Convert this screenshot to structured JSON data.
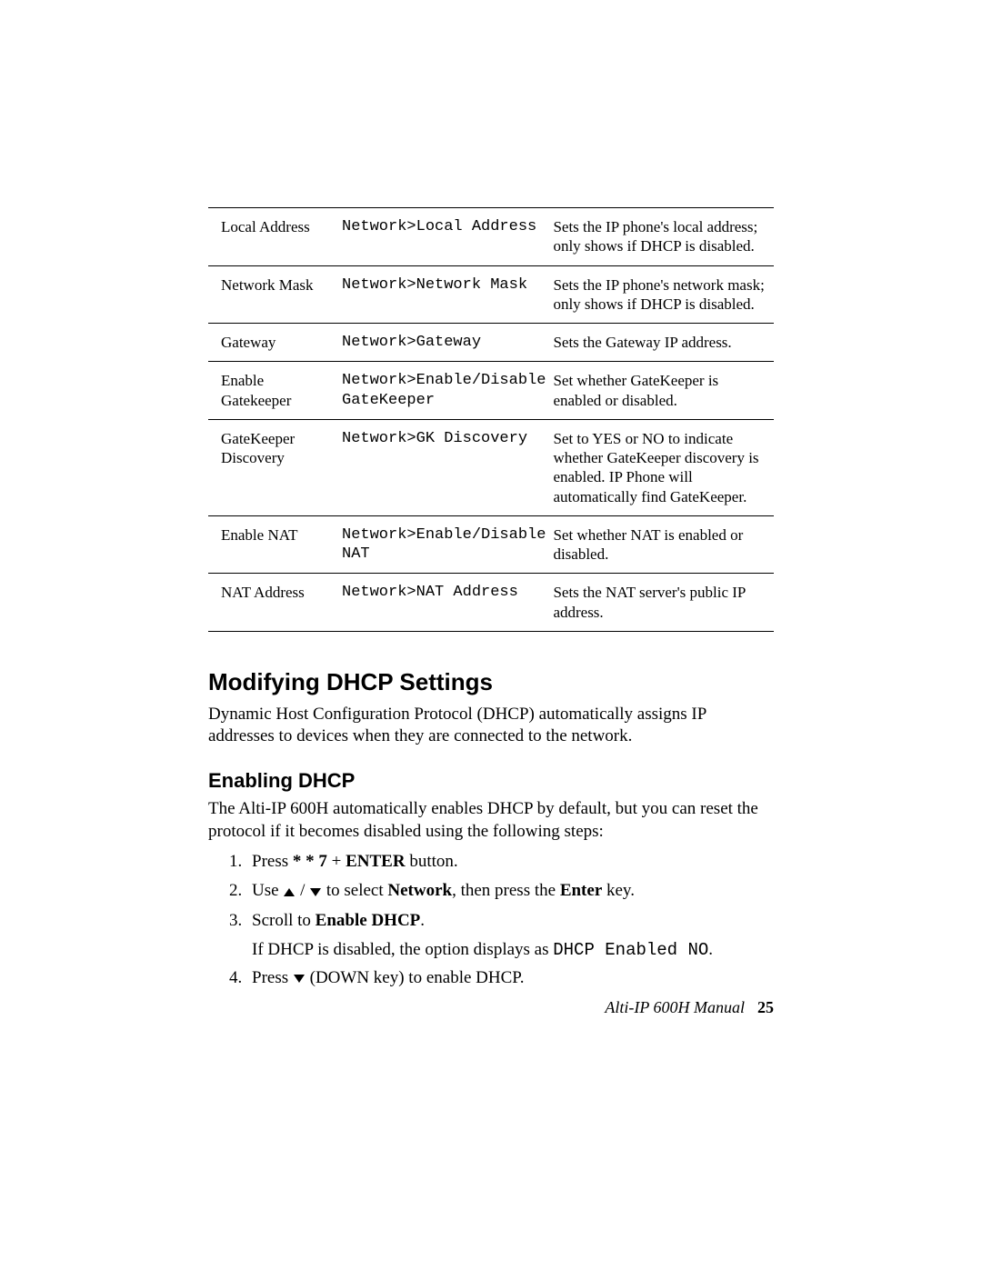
{
  "table": {
    "rows": [
      {
        "name": "Local Address",
        "path": "Network>Local Address",
        "desc": "Sets the IP phone's local address; only shows if DHCP is disabled."
      },
      {
        "name": "Network Mask",
        "path": "Network>Network Mask",
        "desc": "Sets the IP phone's network mask; only shows if DHCP is disabled."
      },
      {
        "name": "Gateway",
        "path": "Network>Gateway",
        "desc": "Sets the Gateway IP address."
      },
      {
        "name": "Enable Gatekeeper",
        "path": "Network>Enable/Disable GateKeeper",
        "desc": "Set whether GateKeeper is enabled or disabled."
      },
      {
        "name": "GateKeeper Discovery",
        "path": "Network>GK Discovery",
        "desc": "Set to YES or NO to indicate whether GateKeeper discovery is enabled. IP Phone will automatically find GateKeeper."
      },
      {
        "name": "Enable NAT",
        "path": "Network>Enable/Disable NAT",
        "desc": "Set whether NAT is enabled or disabled."
      },
      {
        "name": "NAT Address",
        "path": "Network>NAT Address",
        "desc": "Sets the NAT server's public IP address."
      }
    ]
  },
  "section_heading": "Modifying DHCP Settings",
  "section_body": "Dynamic Host Configuration Protocol (DHCP) automatically assigns IP addresses to devices when they are connected to the network.",
  "subsection_heading": "Enabling DHCP",
  "subsection_body": "The Alti-IP 600H automatically enables DHCP by default, but you can reset the protocol if it becomes disabled using the following steps:",
  "steps": {
    "s1_a": "Press ",
    "s1_b": "* * 7",
    "s1_c": " + ",
    "s1_d": "ENTER",
    "s1_e": " button.",
    "s2_a": "Use ",
    "s2_b": " / ",
    "s2_c": " to select ",
    "s2_d": "Network",
    "s2_e": ", then press the ",
    "s2_f": "Enter",
    "s2_g": " key.",
    "s3_a": "Scroll to ",
    "s3_b": "Enable DHCP",
    "s3_c": ".",
    "s3_note_a": "If DHCP is disabled, the option displays as ",
    "s3_note_b": "DHCP Enabled NO",
    "s3_note_c": ".",
    "s4_a": "Press ",
    "s4_b": " (DOWN key) to enable DHCP."
  },
  "footer": {
    "title": "Alti-IP 600H Manual",
    "page": "25"
  }
}
